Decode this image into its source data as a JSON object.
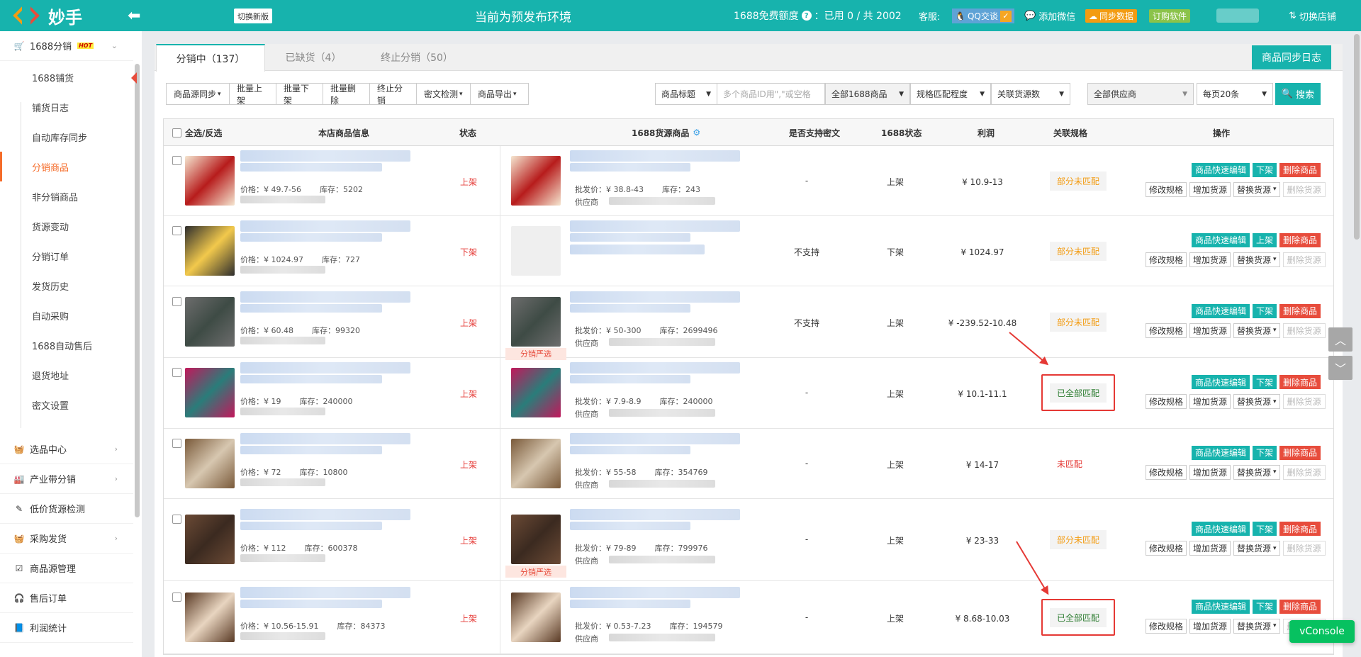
{
  "topbar": {
    "app_name": "妙手",
    "switch_new": "切换新版",
    "env_title": "当前为预发布环境",
    "quota_label": "1688免费额度",
    "quota_value": "：已用 0 / 共 2002",
    "kefu_label": "客服:",
    "qq_label": "QQ交谈",
    "wechat_label": "添加微信",
    "sync_label": "同步数据",
    "order_label": "订购软件",
    "switch_store": "切换店铺"
  },
  "sidebar": {
    "group_main": {
      "label": "1688分销",
      "badge": "HOT"
    },
    "sub_items": [
      {
        "label": "1688铺货",
        "active": false
      },
      {
        "label": "铺货日志",
        "active": false
      },
      {
        "label": "自动库存同步",
        "active": false
      },
      {
        "label": "分销商品",
        "active": true
      },
      {
        "label": "非分销商品",
        "active": false
      },
      {
        "label": "货源变动",
        "active": false
      },
      {
        "label": "分销订单",
        "active": false
      },
      {
        "label": "发货历史",
        "active": false
      },
      {
        "label": "自动采购",
        "active": false
      },
      {
        "label": "1688自动售后",
        "active": false
      },
      {
        "label": "退货地址",
        "active": false
      },
      {
        "label": "密文设置",
        "active": false
      }
    ],
    "groups": [
      {
        "label": "选品中心",
        "icon": "basket-icon",
        "has_arrow": true
      },
      {
        "label": "产业带分销",
        "icon": "factory-icon",
        "has_arrow": true
      },
      {
        "label": "低价货源检测",
        "icon": "edit-icon",
        "has_arrow": false
      },
      {
        "label": "采购发货",
        "icon": "basket-icon",
        "has_arrow": true
      },
      {
        "label": "商品源管理",
        "icon": "check-square-icon",
        "has_arrow": false
      },
      {
        "label": "售后订单",
        "icon": "headset-icon",
        "has_arrow": false
      },
      {
        "label": "利润统计",
        "icon": "book-icon",
        "has_arrow": false
      }
    ]
  },
  "tabs": [
    {
      "label": "分销中（137）",
      "active": true
    },
    {
      "label": "已缺货（4）",
      "active": false
    },
    {
      "label": "终止分销（50）",
      "active": false
    }
  ],
  "log_button": "商品同步日志",
  "toolbar": [
    {
      "label": "商品源同步",
      "dropdown": true
    },
    {
      "label": "批量上架",
      "dropdown": false
    },
    {
      "label": "批量下架",
      "dropdown": false
    },
    {
      "label": "批量删除",
      "dropdown": false
    },
    {
      "label": "终止分销",
      "dropdown": false
    },
    {
      "label": "密文检测",
      "dropdown": true
    },
    {
      "label": "商品导出",
      "dropdown": true
    }
  ],
  "filters": {
    "title_select": "商品标题",
    "id_placeholder": "多个商品ID用\",\"或空格",
    "all_1688": "全部1688商品",
    "spec_match": "规格匹配程度",
    "link_count": "关联货源数",
    "supplier": "全部供应商",
    "page_size": "每页20条",
    "search": "搜索"
  },
  "table": {
    "headers": {
      "select_all": "全选/反选",
      "store_info": "本店商品信息",
      "status": "状态",
      "source": "1688货源商品",
      "cipher": "是否支持密文",
      "status_1688": "1688状态",
      "profit": "利润",
      "spec": "关联规格",
      "ops": "操作"
    },
    "labels": {
      "price": "价格：",
      "stock": "库存：",
      "wholesale": "批发价：",
      "supplier": "供应商",
      "fenxiao_tag": "分销严选"
    },
    "rows": [
      {
        "price": "¥ 49.7-56",
        "stock": "5202",
        "status": "上架",
        "wprice": "¥ 38.8-43",
        "wstock": "243",
        "cipher": "-",
        "s1688": "上架",
        "profit": "¥ 10.9-13",
        "spec": "部分未匹配",
        "spec_type": "part",
        "toggle": "下架",
        "fenxiao": false
      },
      {
        "price": "¥ 1024.97",
        "stock": "727",
        "status": "下架",
        "wprice": "",
        "wstock": "",
        "cipher": "不支持",
        "s1688": "下架",
        "profit": "¥ 1024.97",
        "spec": "部分未匹配",
        "spec_type": "part",
        "toggle": "上架",
        "fenxiao": false
      },
      {
        "price": "¥ 60.48",
        "stock": "99320",
        "status": "上架",
        "wprice": "¥ 50-300",
        "wstock": "2699496",
        "cipher": "不支持",
        "s1688": "上架",
        "profit": "¥ -239.52-10.48",
        "spec": "部分未匹配",
        "spec_type": "part",
        "toggle": "下架",
        "fenxiao": true
      },
      {
        "price": "¥ 19",
        "stock": "240000",
        "status": "上架",
        "wprice": "¥ 7.9-8.9",
        "wstock": "240000",
        "cipher": "-",
        "s1688": "上架",
        "profit": "¥ 10.1-11.1",
        "spec": "已全部匹配",
        "spec_type": "all",
        "toggle": "下架",
        "fenxiao": false
      },
      {
        "price": "¥ 72",
        "stock": "10800",
        "status": "上架",
        "wprice": "¥ 55-58",
        "wstock": "354769",
        "cipher": "-",
        "s1688": "上架",
        "profit": "¥ 14-17",
        "spec": "未匹配",
        "spec_type": "none",
        "toggle": "下架",
        "fenxiao": false
      },
      {
        "price": "¥ 112",
        "stock": "600378",
        "status": "上架",
        "wprice": "¥ 79-89",
        "wstock": "799976",
        "cipher": "-",
        "s1688": "上架",
        "profit": "¥ 23-33",
        "spec": "部分未匹配",
        "spec_type": "part",
        "toggle": "下架",
        "fenxiao": true
      },
      {
        "price": "¥ 10.56-15.91",
        "stock": "84373",
        "status": "上架",
        "wprice": "¥ 0.53-7.23",
        "wstock": "194579",
        "cipher": "-",
        "s1688": "上架",
        "profit": "¥ 8.68-10.03",
        "spec": "已全部匹配",
        "spec_type": "all",
        "toggle": "下架",
        "fenxiao": false
      }
    ],
    "ops": {
      "quick_edit": "商品快速编辑",
      "delete": "删除商品",
      "modify_spec": "修改规格",
      "add_source": "增加货源",
      "replace_source": "替换货源",
      "remove_source": "删除货源"
    }
  },
  "vconsole": "vConsole"
}
